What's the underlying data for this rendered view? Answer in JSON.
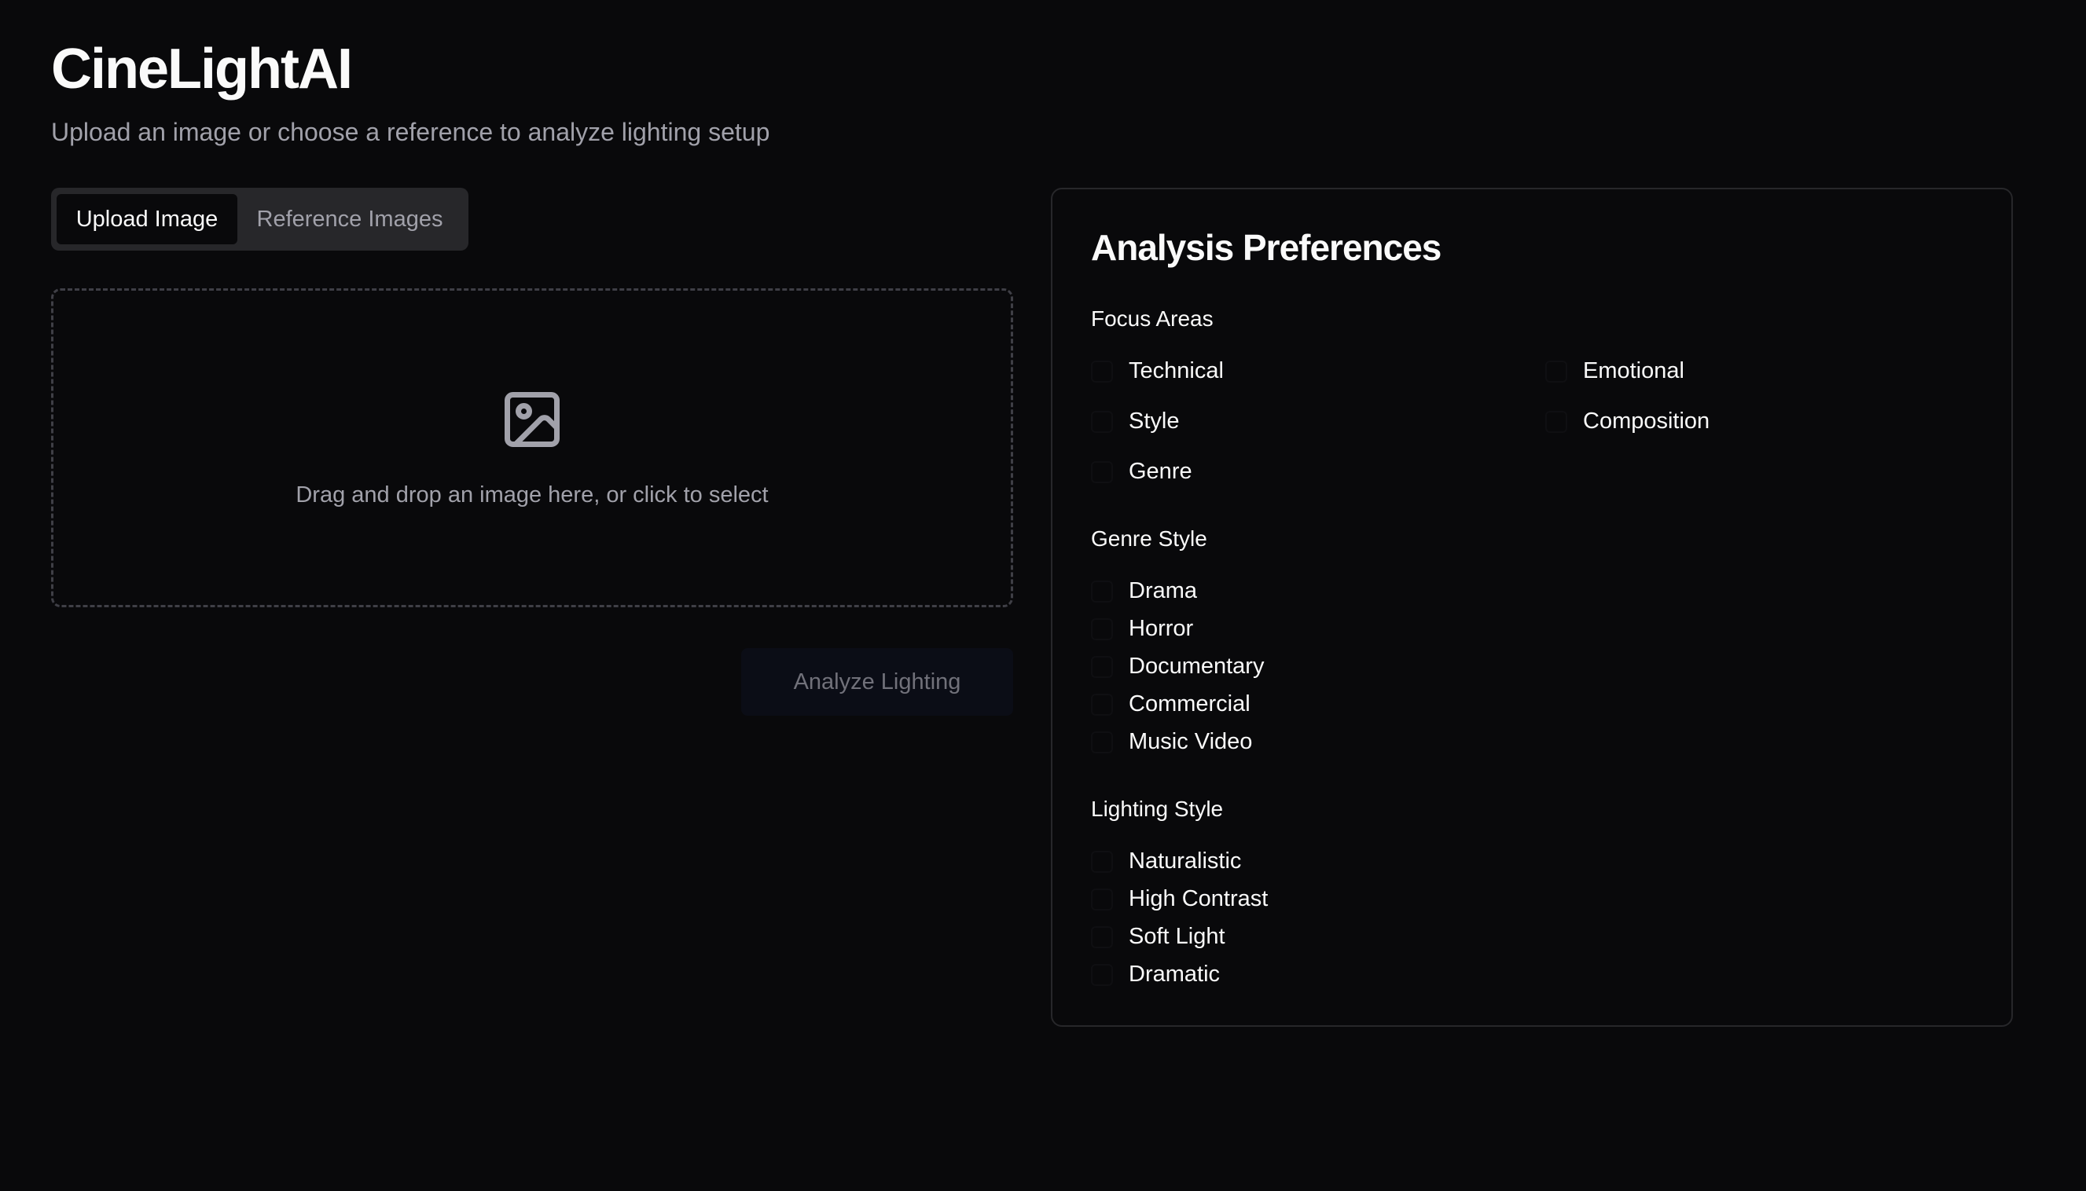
{
  "header": {
    "title": "CineLightAI",
    "subtitle": "Upload an image or choose a reference to analyze lighting setup"
  },
  "tabs": [
    {
      "label": "Upload Image",
      "active": true
    },
    {
      "label": "Reference Images",
      "active": false
    }
  ],
  "dropzone": {
    "icon": "image-icon",
    "text": "Drag and drop an image here, or click to select"
  },
  "analyze_button": {
    "label": "Analyze Lighting",
    "disabled": true
  },
  "preferences": {
    "title": "Analysis Preferences",
    "focus_areas": {
      "label": "Focus Areas",
      "options": [
        "Technical",
        "Emotional",
        "Style",
        "Composition",
        "Genre"
      ]
    },
    "genre_style": {
      "label": "Genre Style",
      "options": [
        "Drama",
        "Horror",
        "Documentary",
        "Commercial",
        "Music Video"
      ]
    },
    "lighting_style": {
      "label": "Lighting Style",
      "options": [
        "Naturalistic",
        "High Contrast",
        "Soft Light",
        "Dramatic"
      ]
    }
  },
  "colors": {
    "background": "#09090b",
    "text": "#fafafa",
    "muted_text": "#a1a1aa",
    "border": "#27272a"
  }
}
